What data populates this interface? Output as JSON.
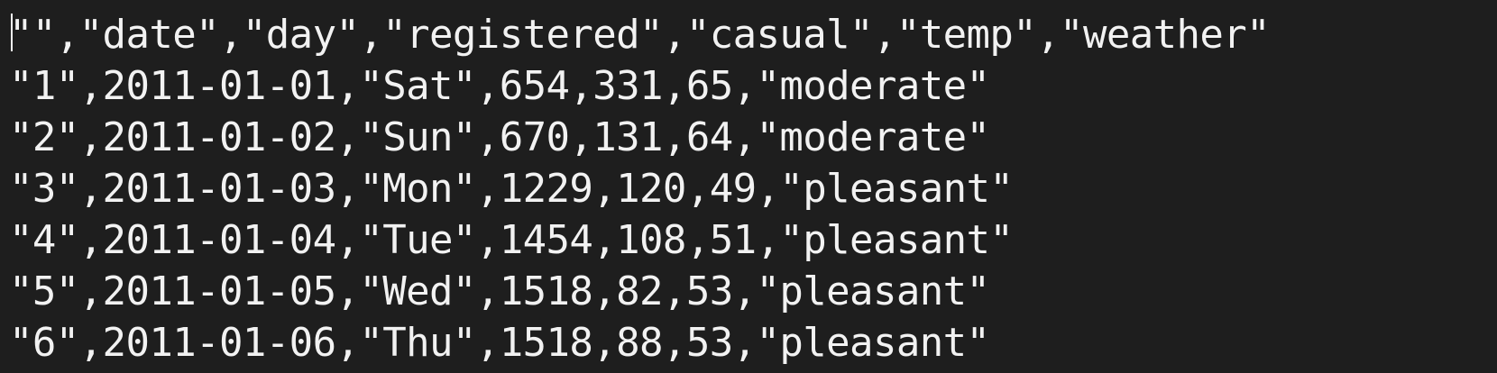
{
  "editor": {
    "lines": [
      "\"\",\"date\",\"day\",\"registered\",\"casual\",\"temp\",\"weather\"",
      "\"1\",2011-01-01,\"Sat\",654,331,65,\"moderate\"",
      "\"2\",2011-01-02,\"Sun\",670,131,64,\"moderate\"",
      "\"3\",2011-01-03,\"Mon\",1229,120,49,\"pleasant\"",
      "\"4\",2011-01-04,\"Tue\",1454,108,51,\"pleasant\"",
      "\"5\",2011-01-05,\"Wed\",1518,82,53,\"pleasant\"",
      "\"6\",2011-01-06,\"Thu\",1518,88,53,\"pleasant\""
    ]
  },
  "colors": {
    "background": "#1e1e1e",
    "text": "#f2f2f2"
  }
}
